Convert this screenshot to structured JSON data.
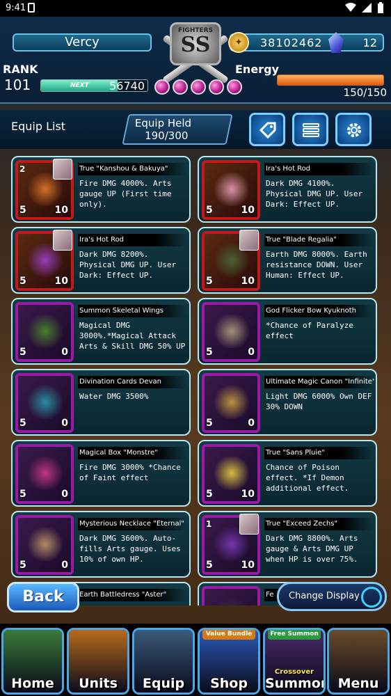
{
  "status": {
    "time": "9:41"
  },
  "header": {
    "player_name": "Vercy",
    "rank_label": "RANK",
    "rank_value": "101",
    "exp_next_label": "NEXT",
    "exp_next_value": "56740",
    "exp_progress": 0.72,
    "emblem_top": "FIGHTERS",
    "emblem_main": "SS",
    "gold": "38102462",
    "gems": "12",
    "energy_label": "Energy",
    "energy_value": "150/150",
    "energy_progress": 1.0,
    "orb_count": 5
  },
  "equip_bar": {
    "title": "Equip List",
    "held_label": "Equip Held",
    "held_count": "190/300",
    "buttons": [
      "tag-icon",
      "sliders-icon",
      "gear-icon"
    ]
  },
  "cards": [
    {
      "name": "True \"Kanshou & Bakuya\"",
      "desc": "Fire DMG 4000%. Arts gauge UP (First time only).",
      "frame": "red",
      "stars": "5",
      "level": "10",
      "badge": "2",
      "portrait": true,
      "art": "#e07a2a"
    },
    {
      "name": "Ira's Hot Rod",
      "desc": "Dark DMG 4100%. Physical DMG UP. User Dark: Effect UP.",
      "frame": "red",
      "stars": "5",
      "level": "10",
      "badge": "",
      "portrait": false,
      "art": "#e8a0b8"
    },
    {
      "name": "Ira's Hot Rod",
      "desc": "Dark DMG 8200%. Physical DMG UP. User Dark: Effect UP.",
      "frame": "red",
      "stars": "5",
      "level": "10",
      "badge": "",
      "portrait": true,
      "art": "#a040d0"
    },
    {
      "name": "True \"Blade Regalia\"",
      "desc": "Earth DMG 8000%. Earth resistance DOWN. User Human: Effect UP.",
      "frame": "red",
      "stars": "5",
      "level": "10",
      "badge": "",
      "portrait": true,
      "art": "#4a6a3a"
    },
    {
      "name": "Summon Skeletal Wings",
      "desc": "Magical DMG 3000%.*Magical Attack Arts & Skill DMG 50% UP",
      "frame": "purple",
      "stars": "5",
      "level": "0",
      "badge": "",
      "portrait": false,
      "art": "#4a8a2a"
    },
    {
      "name": "God Flicker Bow Kyuknoth",
      "desc": "*Chance of Paralyze effect",
      "frame": "purple",
      "stars": "5",
      "level": "0",
      "badge": "",
      "portrait": false,
      "art": "#b0a080"
    },
    {
      "name": "Divination Cards Devan",
      "desc": "Water DMG 3500%",
      "frame": "purple",
      "stars": "5",
      "level": "0",
      "badge": "",
      "portrait": false,
      "art": "#2a9aaa"
    },
    {
      "name": "Ultimate Magic Canon \"Infinite\"",
      "desc": "Light DMG 6000% Own DEF 30% DOWN",
      "frame": "purple",
      "stars": "5",
      "level": "0",
      "badge": "",
      "portrait": false,
      "art": "#c8a040"
    },
    {
      "name": "Magical Box \"Monstre\"",
      "desc": "Fire DMG 3000% *Chance of Faint effect",
      "frame": "purple",
      "stars": "5",
      "level": "0",
      "badge": "",
      "portrait": false,
      "art": "#d03a8a"
    },
    {
      "name": "True \"Sans Pluie\"",
      "desc": "Chance of Poison effect. *If Demon additional effect.",
      "frame": "purple",
      "stars": "5",
      "level": "10",
      "badge": "",
      "portrait": false,
      "art": "#e8d040"
    },
    {
      "name": "Mysterious Necklace \"Eternal\"",
      "desc": "Dark DMG 3600%. Auto-fills Arts gauge. Uses 10% of own HP.",
      "frame": "purple",
      "stars": "5",
      "level": "0",
      "badge": "",
      "portrait": false,
      "art": "#c09a6a"
    },
    {
      "name": "True \"Exceed Zechs\"",
      "desc": "Dark DMG 8800%. Arts gauge & Arts DMG UP when HP is over 75%.",
      "frame": "purple",
      "stars": "5",
      "level": "10",
      "badge": "1",
      "portrait": true,
      "art": "#7a3ab8"
    },
    {
      "name": "Earth Battledress \"Aster\"",
      "desc": "",
      "frame": "purple",
      "stars": "",
      "level": "",
      "badge": "",
      "portrait": false,
      "art": "#5a5a3a"
    },
    {
      "name": "Fe",
      "desc": "",
      "frame": "purple",
      "stars": "",
      "level": "",
      "badge": "",
      "portrait": false,
      "art": "#3a3a3a"
    }
  ],
  "buttons": {
    "back": "Back",
    "change_display": "Change Display"
  },
  "nav": [
    {
      "label": "Home",
      "tag": "",
      "sub": "",
      "bg": "#3a7a3a"
    },
    {
      "label": "Units",
      "tag": "",
      "sub": "",
      "bg": "#b86a1a"
    },
    {
      "label": "Equip",
      "tag": "",
      "sub": "",
      "bg": "#3a5a7a"
    },
    {
      "label": "Shop",
      "tag": "Value Bundle",
      "sub": "",
      "bg": "#2a5ab8"
    },
    {
      "label": "Summon",
      "tag": "Free Summon",
      "sub": "Crossover",
      "bg": "#4a2a6a"
    },
    {
      "label": "Menu",
      "tag": "",
      "sub": "",
      "bg": "#6a4a2a"
    }
  ]
}
